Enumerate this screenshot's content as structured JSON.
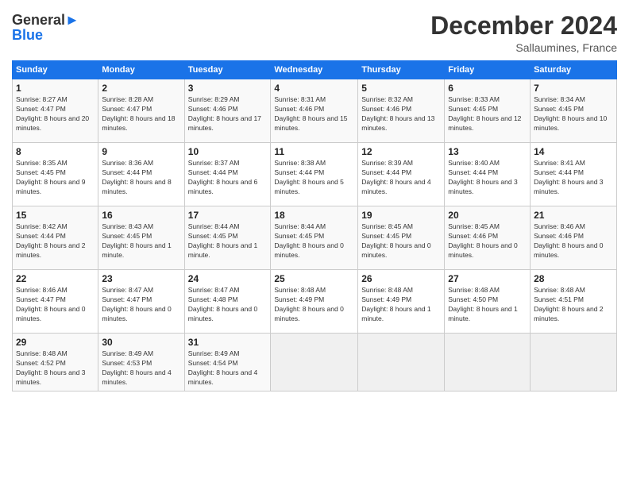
{
  "header": {
    "logo_line1": "General",
    "logo_line2": "Blue",
    "month_title": "December 2024",
    "subtitle": "Sallaumines, France"
  },
  "weekdays": [
    "Sunday",
    "Monday",
    "Tuesday",
    "Wednesday",
    "Thursday",
    "Friday",
    "Saturday"
  ],
  "weeks": [
    [
      {
        "day": "1",
        "sunrise": "8:27 AM",
        "sunset": "4:47 PM",
        "daylight": "8 hours and 20 minutes."
      },
      {
        "day": "2",
        "sunrise": "8:28 AM",
        "sunset": "4:47 PM",
        "daylight": "8 hours and 18 minutes."
      },
      {
        "day": "3",
        "sunrise": "8:29 AM",
        "sunset": "4:46 PM",
        "daylight": "8 hours and 17 minutes."
      },
      {
        "day": "4",
        "sunrise": "8:31 AM",
        "sunset": "4:46 PM",
        "daylight": "8 hours and 15 minutes."
      },
      {
        "day": "5",
        "sunrise": "8:32 AM",
        "sunset": "4:46 PM",
        "daylight": "8 hours and 13 minutes."
      },
      {
        "day": "6",
        "sunrise": "8:33 AM",
        "sunset": "4:45 PM",
        "daylight": "8 hours and 12 minutes."
      },
      {
        "day": "7",
        "sunrise": "8:34 AM",
        "sunset": "4:45 PM",
        "daylight": "8 hours and 10 minutes."
      }
    ],
    [
      {
        "day": "8",
        "sunrise": "8:35 AM",
        "sunset": "4:45 PM",
        "daylight": "8 hours and 9 minutes."
      },
      {
        "day": "9",
        "sunrise": "8:36 AM",
        "sunset": "4:44 PM",
        "daylight": "8 hours and 8 minutes."
      },
      {
        "day": "10",
        "sunrise": "8:37 AM",
        "sunset": "4:44 PM",
        "daylight": "8 hours and 6 minutes."
      },
      {
        "day": "11",
        "sunrise": "8:38 AM",
        "sunset": "4:44 PM",
        "daylight": "8 hours and 5 minutes."
      },
      {
        "day": "12",
        "sunrise": "8:39 AM",
        "sunset": "4:44 PM",
        "daylight": "8 hours and 4 minutes."
      },
      {
        "day": "13",
        "sunrise": "8:40 AM",
        "sunset": "4:44 PM",
        "daylight": "8 hours and 3 minutes."
      },
      {
        "day": "14",
        "sunrise": "8:41 AM",
        "sunset": "4:44 PM",
        "daylight": "8 hours and 3 minutes."
      }
    ],
    [
      {
        "day": "15",
        "sunrise": "8:42 AM",
        "sunset": "4:44 PM",
        "daylight": "8 hours and 2 minutes."
      },
      {
        "day": "16",
        "sunrise": "8:43 AM",
        "sunset": "4:45 PM",
        "daylight": "8 hours and 1 minute."
      },
      {
        "day": "17",
        "sunrise": "8:44 AM",
        "sunset": "4:45 PM",
        "daylight": "8 hours and 1 minute."
      },
      {
        "day": "18",
        "sunrise": "8:44 AM",
        "sunset": "4:45 PM",
        "daylight": "8 hours and 0 minutes."
      },
      {
        "day": "19",
        "sunrise": "8:45 AM",
        "sunset": "4:45 PM",
        "daylight": "8 hours and 0 minutes."
      },
      {
        "day": "20",
        "sunrise": "8:45 AM",
        "sunset": "4:46 PM",
        "daylight": "8 hours and 0 minutes."
      },
      {
        "day": "21",
        "sunrise": "8:46 AM",
        "sunset": "4:46 PM",
        "daylight": "8 hours and 0 minutes."
      }
    ],
    [
      {
        "day": "22",
        "sunrise": "8:46 AM",
        "sunset": "4:47 PM",
        "daylight": "8 hours and 0 minutes."
      },
      {
        "day": "23",
        "sunrise": "8:47 AM",
        "sunset": "4:47 PM",
        "daylight": "8 hours and 0 minutes."
      },
      {
        "day": "24",
        "sunrise": "8:47 AM",
        "sunset": "4:48 PM",
        "daylight": "8 hours and 0 minutes."
      },
      {
        "day": "25",
        "sunrise": "8:48 AM",
        "sunset": "4:49 PM",
        "daylight": "8 hours and 0 minutes."
      },
      {
        "day": "26",
        "sunrise": "8:48 AM",
        "sunset": "4:49 PM",
        "daylight": "8 hours and 1 minute."
      },
      {
        "day": "27",
        "sunrise": "8:48 AM",
        "sunset": "4:50 PM",
        "daylight": "8 hours and 1 minute."
      },
      {
        "day": "28",
        "sunrise": "8:48 AM",
        "sunset": "4:51 PM",
        "daylight": "8 hours and 2 minutes."
      }
    ],
    [
      {
        "day": "29",
        "sunrise": "8:48 AM",
        "sunset": "4:52 PM",
        "daylight": "8 hours and 3 minutes."
      },
      {
        "day": "30",
        "sunrise": "8:49 AM",
        "sunset": "4:53 PM",
        "daylight": "8 hours and 4 minutes."
      },
      {
        "day": "31",
        "sunrise": "8:49 AM",
        "sunset": "4:54 PM",
        "daylight": "8 hours and 4 minutes."
      },
      null,
      null,
      null,
      null
    ]
  ]
}
